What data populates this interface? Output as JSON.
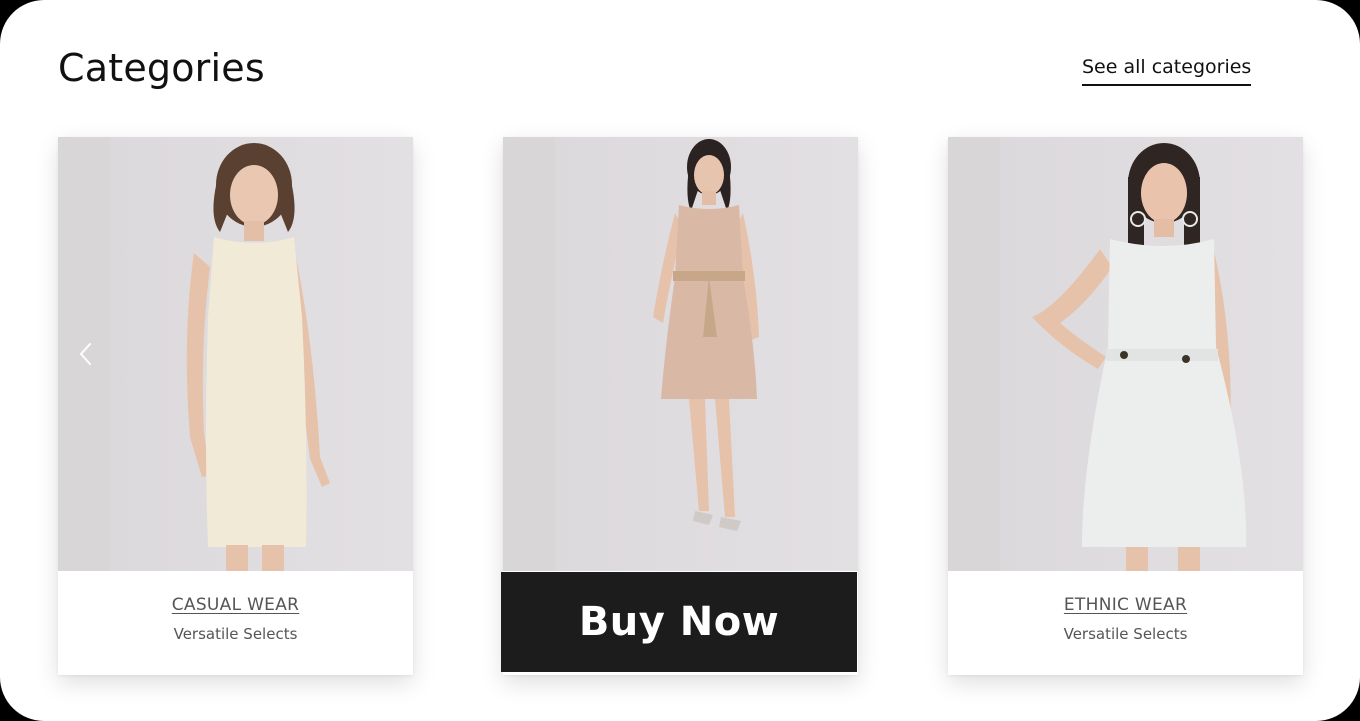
{
  "header": {
    "title": "Categories",
    "see_all_label": "See all categories"
  },
  "cards": [
    {
      "name": "CASUAL WEAR",
      "subtitle": "Versatile Selects",
      "dress_color": "#f1ead7"
    },
    {
      "name": "",
      "subtitle": "",
      "cta_label": "Buy Now",
      "dress_color": "#d9b8a6"
    },
    {
      "name": "ETHNIC WEAR",
      "subtitle": "Versatile Selects",
      "dress_color": "#eceeee"
    }
  ],
  "carousel": {
    "prev_icon": "chevron-left-icon"
  },
  "colors": {
    "page_bg": "#ffffff",
    "buy_button_bg": "#1c1c1d",
    "label_text": "#555555"
  }
}
